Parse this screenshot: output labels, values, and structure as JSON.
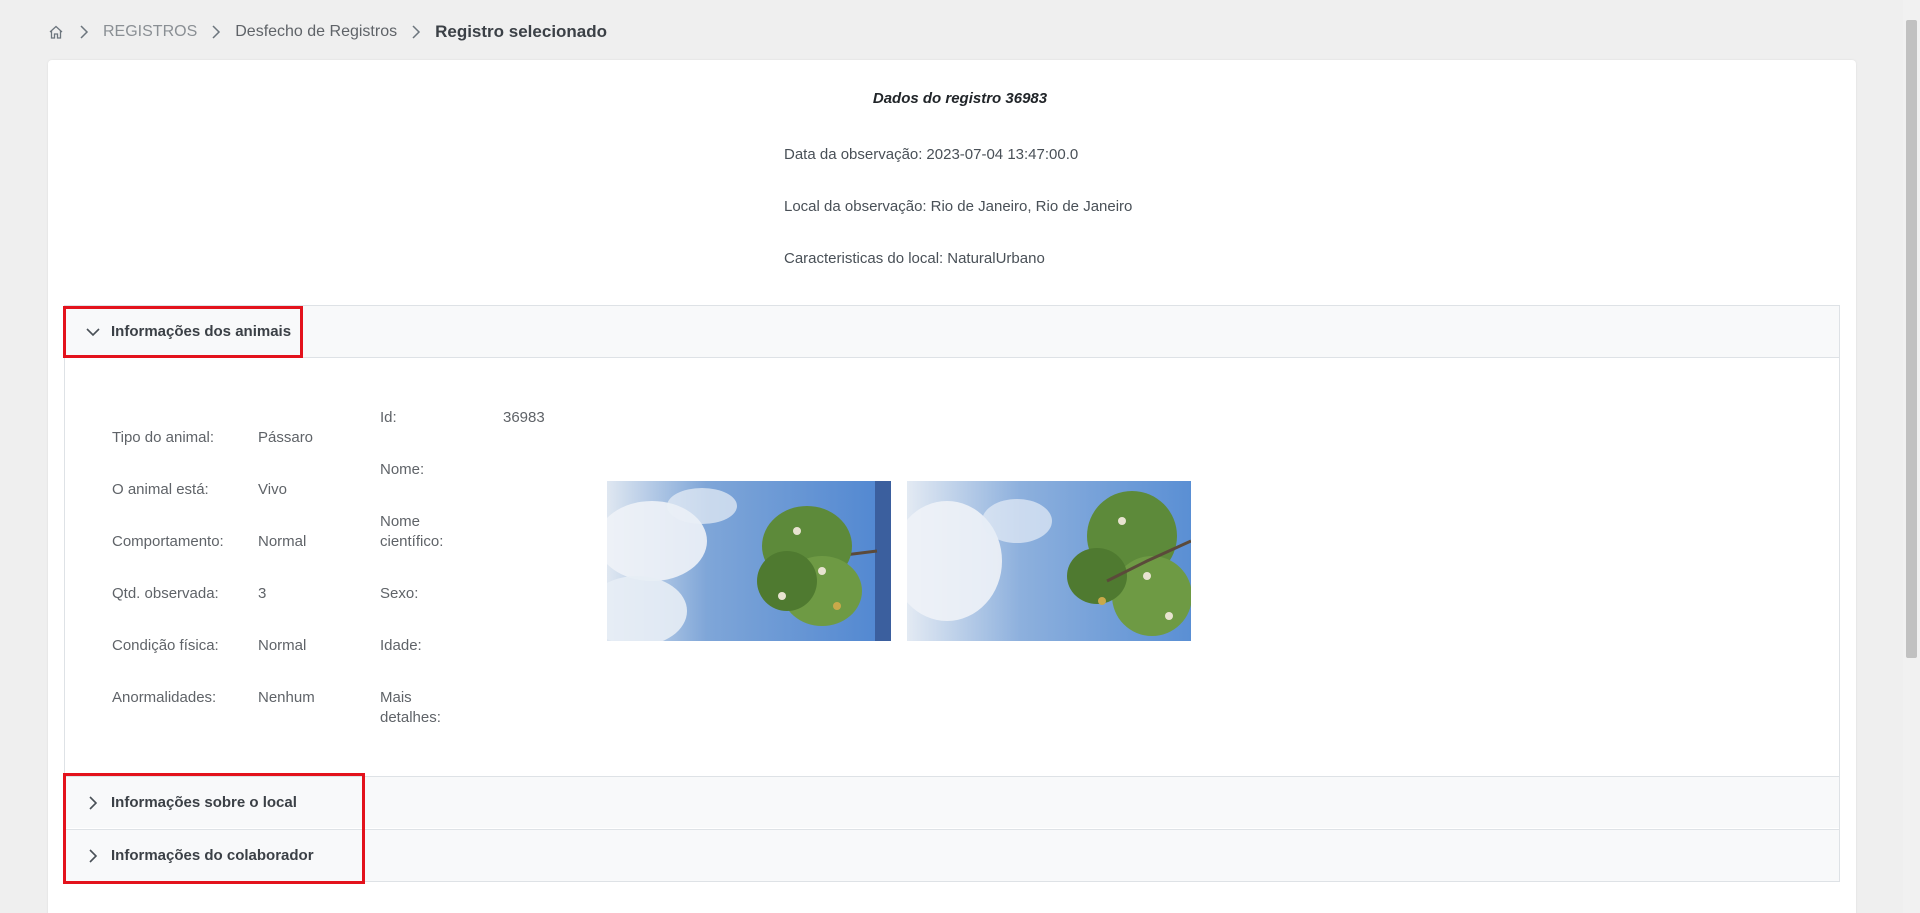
{
  "breadcrumb": {
    "home_icon": "home-icon",
    "items": [
      "REGISTROS",
      "Desfecho de Registros"
    ],
    "current": "Registro selecionado"
  },
  "record": {
    "title": "Dados do registro 36983",
    "observation_date_label": "Data da observação:",
    "observation_date": "2023-07-04 13:47:00.0",
    "location_label": "Local da observação:",
    "location": "Rio de Janeiro, Rio de Janeiro",
    "site_label": "Caracteristicas do local:",
    "site": "NaturalUrbano"
  },
  "accordion": {
    "animals_header": "Informações dos animais",
    "place_header": "Informações sobre o local",
    "collaborator_header": "Informações do colaborador"
  },
  "animal_fields": [
    {
      "label": "Tipo do animal:",
      "value": "Pássaro"
    },
    {
      "label": "O animal está:",
      "value": "Vivo"
    },
    {
      "label": "Comportamento:",
      "value": "Normal"
    },
    {
      "label": "Qtd. observada:",
      "value": "3"
    },
    {
      "label": "Condição física:",
      "value": "Normal"
    },
    {
      "label": "Anormalidades:",
      "value": "Nenhum"
    }
  ],
  "detail_fields": [
    {
      "label": "Id:",
      "value": "36983"
    },
    {
      "label": "Nome:",
      "value": ""
    },
    {
      "label": "Nome científico:",
      "value": ""
    },
    {
      "label": "Sexo:",
      "value": ""
    },
    {
      "label": "Idade:",
      "value": ""
    },
    {
      "label": "Mais detalhes:",
      "value": ""
    }
  ],
  "colors": {
    "highlight": "#e3121c",
    "background": "#efefef",
    "card": "#ffffff"
  }
}
